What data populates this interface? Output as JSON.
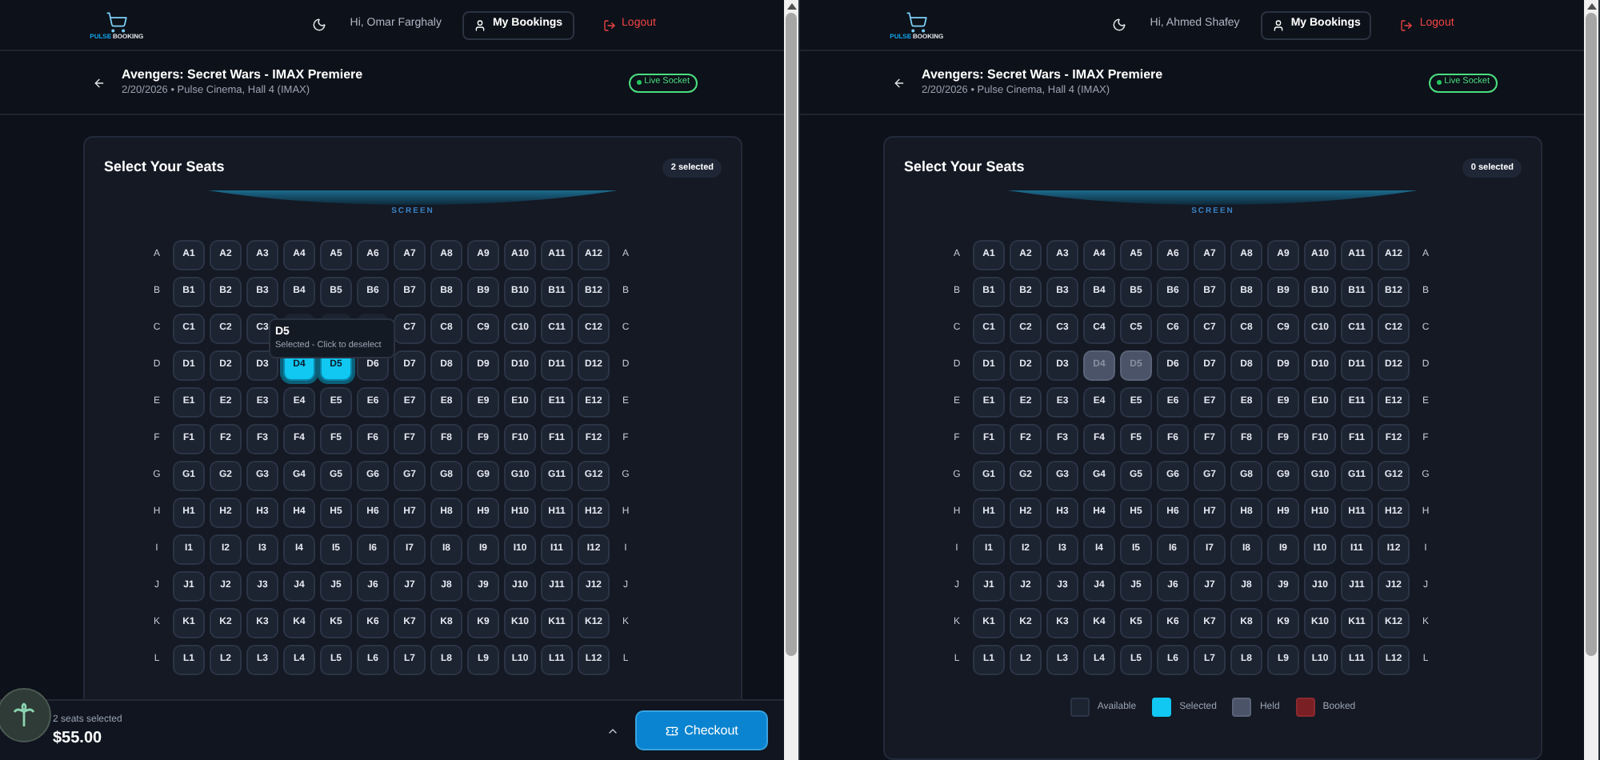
{
  "panes": [
    {
      "header": {
        "brand": [
          "PULSE",
          "BOOKING"
        ],
        "greeting": "Hi, Omar Farghaly",
        "bookings": "My Bookings",
        "logout": "Logout"
      },
      "event": {
        "title": "Avengers: Secret Wars - IMAX Premiere",
        "subtitle": "2/20/2026 • Pulse Cinema, Hall 4 (IMAX)",
        "status": "Live Socket"
      },
      "seat_map": {
        "title": "Select Your Seats",
        "count": "2 selected",
        "screen": "SCREEN",
        "rows": [
          {
            "label": "A",
            "label_right": "A",
            "seats": [
              {
                "label": "A1",
                "kind": "available"
              },
              {
                "label": "A2",
                "kind": "available"
              },
              {
                "label": "A3",
                "kind": "available"
              },
              {
                "label": "A4",
                "kind": "available"
              },
              {
                "label": "A5",
                "kind": "available"
              },
              {
                "label": "A6",
                "kind": "available"
              },
              {
                "label": "A7",
                "kind": "available"
              },
              {
                "label": "A8",
                "kind": "available"
              },
              {
                "label": "A9",
                "kind": "available"
              },
              {
                "label": "A10",
                "kind": "available"
              },
              {
                "label": "A11",
                "kind": "available"
              },
              {
                "label": "A12",
                "kind": "available"
              }
            ]
          },
          {
            "label": "B",
            "label_right": "B",
            "seats": [
              {
                "label": "B1",
                "kind": "available"
              },
              {
                "label": "B2",
                "kind": "available"
              },
              {
                "label": "B3",
                "kind": "available"
              },
              {
                "label": "B4",
                "kind": "available"
              },
              {
                "label": "B5",
                "kind": "available"
              },
              {
                "label": "B6",
                "kind": "available"
              },
              {
                "label": "B7",
                "kind": "available"
              },
              {
                "label": "B8",
                "kind": "available"
              },
              {
                "label": "B9",
                "kind": "available"
              },
              {
                "label": "B10",
                "kind": "available"
              },
              {
                "label": "B11",
                "kind": "available"
              },
              {
                "label": "B12",
                "kind": "available"
              }
            ]
          },
          {
            "label": "C",
            "label_right": "C",
            "seats": [
              {
                "label": "C1",
                "kind": "available"
              },
              {
                "label": "C2",
                "kind": "available"
              },
              {
                "label": "C3",
                "kind": "available"
              },
              {
                "kind": "covered"
              },
              {
                "kind": "covered"
              },
              {
                "kind": "covered"
              },
              {
                "label": "C7",
                "kind": "available"
              },
              {
                "label": "C8",
                "kind": "available"
              },
              {
                "label": "C9",
                "kind": "available"
              },
              {
                "label": "C10",
                "kind": "available"
              },
              {
                "label": "C11",
                "kind": "available"
              },
              {
                "label": "C12",
                "kind": "available"
              }
            ]
          },
          {
            "label": "D",
            "label_right": "D",
            "seats": [
              {
                "label": "D1",
                "kind": "available"
              },
              {
                "label": "D2",
                "kind": "available"
              },
              {
                "label": "D3",
                "kind": "available"
              },
              {
                "label": "D4",
                "kind": "selected"
              },
              {
                "label": "D5",
                "kind": "selected"
              },
              {
                "label": "D6",
                "kind": "available"
              },
              {
                "label": "D7",
                "kind": "available"
              },
              {
                "label": "D8",
                "kind": "available"
              },
              {
                "label": "D9",
                "kind": "available"
              },
              {
                "label": "D10",
                "kind": "available"
              },
              {
                "label": "D11",
                "kind": "available"
              },
              {
                "label": "D12",
                "kind": "available"
              }
            ]
          },
          {
            "label": "E",
            "label_right": "E",
            "seats": [
              {
                "label": "E1",
                "kind": "available"
              },
              {
                "label": "E2",
                "kind": "available"
              },
              {
                "label": "E3",
                "kind": "available"
              },
              {
                "label": "E4",
                "kind": "available"
              },
              {
                "label": "E5",
                "kind": "available"
              },
              {
                "label": "E6",
                "kind": "available"
              },
              {
                "label": "E7",
                "kind": "available"
              },
              {
                "label": "E8",
                "kind": "available"
              },
              {
                "label": "E9",
                "kind": "available"
              },
              {
                "label": "E10",
                "kind": "available"
              },
              {
                "label": "E11",
                "kind": "available"
              },
              {
                "label": "E12",
                "kind": "available"
              }
            ]
          },
          {
            "label": "F",
            "label_right": "F",
            "seats": [
              {
                "label": "F1",
                "kind": "available"
              },
              {
                "label": "F2",
                "kind": "available"
              },
              {
                "label": "F3",
                "kind": "available"
              },
              {
                "label": "F4",
                "kind": "available"
              },
              {
                "label": "F5",
                "kind": "available"
              },
              {
                "label": "F6",
                "kind": "available"
              },
              {
                "label": "F7",
                "kind": "available"
              },
              {
                "label": "F8",
                "kind": "available"
              },
              {
                "label": "F9",
                "kind": "available"
              },
              {
                "label": "F10",
                "kind": "available"
              },
              {
                "label": "F11",
                "kind": "available"
              },
              {
                "label": "F12",
                "kind": "available"
              }
            ]
          },
          {
            "label": "G",
            "label_right": "G",
            "seats": [
              {
                "label": "G1",
                "kind": "available"
              },
              {
                "label": "G2",
                "kind": "available"
              },
              {
                "label": "G3",
                "kind": "available"
              },
              {
                "label": "G4",
                "kind": "available"
              },
              {
                "label": "G5",
                "kind": "available"
              },
              {
                "label": "G6",
                "kind": "available"
              },
              {
                "label": "G7",
                "kind": "available"
              },
              {
                "label": "G8",
                "kind": "available"
              },
              {
                "label": "G9",
                "kind": "available"
              },
              {
                "label": "G10",
                "kind": "available"
              },
              {
                "label": "G11",
                "kind": "available"
              },
              {
                "label": "G12",
                "kind": "available"
              }
            ]
          },
          {
            "label": "H",
            "label_right": "H",
            "seats": [
              {
                "label": "H1",
                "kind": "available"
              },
              {
                "label": "H2",
                "kind": "available"
              },
              {
                "label": "H3",
                "kind": "available"
              },
              {
                "label": "H4",
                "kind": "available"
              },
              {
                "label": "H5",
                "kind": "available"
              },
              {
                "label": "H6",
                "kind": "available"
              },
              {
                "label": "H7",
                "kind": "available"
              },
              {
                "label": "H8",
                "kind": "available"
              },
              {
                "label": "H9",
                "kind": "available"
              },
              {
                "label": "H10",
                "kind": "available"
              },
              {
                "label": "H11",
                "kind": "available"
              },
              {
                "label": "H12",
                "kind": "available"
              }
            ]
          },
          {
            "label": "I",
            "label_right": "I",
            "seats": [
              {
                "label": "I1",
                "kind": "available"
              },
              {
                "label": "I2",
                "kind": "available"
              },
              {
                "label": "I3",
                "kind": "available"
              },
              {
                "label": "I4",
                "kind": "available"
              },
              {
                "label": "I5",
                "kind": "available"
              },
              {
                "label": "I6",
                "kind": "available"
              },
              {
                "label": "I7",
                "kind": "available"
              },
              {
                "label": "I8",
                "kind": "available"
              },
              {
                "label": "I9",
                "kind": "available"
              },
              {
                "label": "I10",
                "kind": "available"
              },
              {
                "label": "I11",
                "kind": "available"
              },
              {
                "label": "I12",
                "kind": "available"
              }
            ]
          },
          {
            "label": "J",
            "label_right": "J",
            "seats": [
              {
                "label": "J1",
                "kind": "available"
              },
              {
                "label": "J2",
                "kind": "available"
              },
              {
                "label": "J3",
                "kind": "available"
              },
              {
                "label": "J4",
                "kind": "available"
              },
              {
                "label": "J5",
                "kind": "available"
              },
              {
                "label": "J6",
                "kind": "available"
              },
              {
                "label": "J7",
                "kind": "available"
              },
              {
                "label": "J8",
                "kind": "available"
              },
              {
                "label": "J9",
                "kind": "available"
              },
              {
                "label": "J10",
                "kind": "available"
              },
              {
                "label": "J11",
                "kind": "available"
              },
              {
                "label": "J12",
                "kind": "available"
              }
            ]
          },
          {
            "label": "K",
            "label_right": "K",
            "seats": [
              {
                "label": "K1",
                "kind": "available"
              },
              {
                "label": "K2",
                "kind": "available"
              },
              {
                "label": "K3",
                "kind": "available"
              },
              {
                "label": "K4",
                "kind": "available"
              },
              {
                "label": "K5",
                "kind": "available"
              },
              {
                "label": "K6",
                "kind": "available"
              },
              {
                "label": "K7",
                "kind": "available"
              },
              {
                "label": "K8",
                "kind": "available"
              },
              {
                "label": "K9",
                "kind": "available"
              },
              {
                "label": "K10",
                "kind": "available"
              },
              {
                "label": "K11",
                "kind": "available"
              },
              {
                "label": "K12",
                "kind": "available"
              }
            ]
          },
          {
            "label": "L",
            "label_right": "L",
            "seats": [
              {
                "label": "L1",
                "kind": "available"
              },
              {
                "label": "L2",
                "kind": "available"
              },
              {
                "label": "L3",
                "kind": "available"
              },
              {
                "label": "L4",
                "kind": "available"
              },
              {
                "label": "L5",
                "kind": "available"
              },
              {
                "label": "L6",
                "kind": "available"
              },
              {
                "label": "L7",
                "kind": "available"
              },
              {
                "label": "L8",
                "kind": "available"
              },
              {
                "label": "L9",
                "kind": "available"
              },
              {
                "label": "L10",
                "kind": "available"
              },
              {
                "label": "L11",
                "kind": "available"
              },
              {
                "label": "L12",
                "kind": "available"
              }
            ]
          }
        ]
      },
      "tooltip": {
        "title": "D5",
        "text": "Selected - Click to deselect"
      },
      "footer": {
        "summary": "2 seats selected",
        "total": "$55.00",
        "checkout": "Checkout"
      }
    },
    {
      "header": {
        "brand": [
          "PULSE",
          "BOOKING"
        ],
        "greeting": "Hi, Ahmed Shafey",
        "bookings": "My Bookings",
        "logout": "Logout"
      },
      "event": {
        "title": "Avengers: Secret Wars - IMAX Premiere",
        "subtitle": "2/20/2026 • Pulse Cinema, Hall 4 (IMAX)",
        "status": "Live Socket"
      },
      "seat_map": {
        "title": "Select Your Seats",
        "count": "0 selected",
        "screen": "SCREEN",
        "rows": [
          {
            "label": "A",
            "label_right": "A",
            "seats": [
              {
                "label": "A1",
                "kind": "available"
              },
              {
                "label": "A2",
                "kind": "available"
              },
              {
                "label": "A3",
                "kind": "available"
              },
              {
                "label": "A4",
                "kind": "available"
              },
              {
                "label": "A5",
                "kind": "available"
              },
              {
                "label": "A6",
                "kind": "available"
              },
              {
                "label": "A7",
                "kind": "available"
              },
              {
                "label": "A8",
                "kind": "available"
              },
              {
                "label": "A9",
                "kind": "available"
              },
              {
                "label": "A10",
                "kind": "available"
              },
              {
                "label": "A11",
                "kind": "available"
              },
              {
                "label": "A12",
                "kind": "available"
              }
            ]
          },
          {
            "label": "B",
            "label_right": "B",
            "seats": [
              {
                "label": "B1",
                "kind": "available"
              },
              {
                "label": "B2",
                "kind": "available"
              },
              {
                "label": "B3",
                "kind": "available"
              },
              {
                "label": "B4",
                "kind": "available"
              },
              {
                "label": "B5",
                "kind": "available"
              },
              {
                "label": "B6",
                "kind": "available"
              },
              {
                "label": "B7",
                "kind": "available"
              },
              {
                "label": "B8",
                "kind": "available"
              },
              {
                "label": "B9",
                "kind": "available"
              },
              {
                "label": "B10",
                "kind": "available"
              },
              {
                "label": "B11",
                "kind": "available"
              },
              {
                "label": "B12",
                "kind": "available"
              }
            ]
          },
          {
            "label": "C",
            "label_right": "C",
            "seats": [
              {
                "label": "C1",
                "kind": "available"
              },
              {
                "label": "C2",
                "kind": "available"
              },
              {
                "label": "C3",
                "kind": "available"
              },
              {
                "label": "C4",
                "kind": "available"
              },
              {
                "label": "C5",
                "kind": "available"
              },
              {
                "label": "C6",
                "kind": "available"
              },
              {
                "label": "C7",
                "kind": "available"
              },
              {
                "label": "C8",
                "kind": "available"
              },
              {
                "label": "C9",
                "kind": "available"
              },
              {
                "label": "C10",
                "kind": "available"
              },
              {
                "label": "C11",
                "kind": "available"
              },
              {
                "label": "C12",
                "kind": "available"
              }
            ]
          },
          {
            "label": "D",
            "label_right": "D",
            "seats": [
              {
                "label": "D1",
                "kind": "available"
              },
              {
                "label": "D2",
                "kind": "available"
              },
              {
                "label": "D3",
                "kind": "available"
              },
              {
                "label": "D4",
                "kind": "held"
              },
              {
                "label": "D5",
                "kind": "held"
              },
              {
                "label": "D6",
                "kind": "available"
              },
              {
                "label": "D7",
                "kind": "available"
              },
              {
                "label": "D8",
                "kind": "available"
              },
              {
                "label": "D9",
                "kind": "available"
              },
              {
                "label": "D10",
                "kind": "available"
              },
              {
                "label": "D11",
                "kind": "available"
              },
              {
                "label": "D12",
                "kind": "available"
              }
            ]
          },
          {
            "label": "E",
            "label_right": "E",
            "seats": [
              {
                "label": "E1",
                "kind": "available"
              },
              {
                "label": "E2",
                "kind": "available"
              },
              {
                "label": "E3",
                "kind": "available"
              },
              {
                "label": "E4",
                "kind": "available"
              },
              {
                "label": "E5",
                "kind": "available"
              },
              {
                "label": "E6",
                "kind": "available"
              },
              {
                "label": "E7",
                "kind": "available"
              },
              {
                "label": "E8",
                "kind": "available"
              },
              {
                "label": "E9",
                "kind": "available"
              },
              {
                "label": "E10",
                "kind": "available"
              },
              {
                "label": "E11",
                "kind": "available"
              },
              {
                "label": "E12",
                "kind": "available"
              }
            ]
          },
          {
            "label": "F",
            "label_right": "F",
            "seats": [
              {
                "label": "F1",
                "kind": "available"
              },
              {
                "label": "F2",
                "kind": "available"
              },
              {
                "label": "F3",
                "kind": "available"
              },
              {
                "label": "F4",
                "kind": "available"
              },
              {
                "label": "F5",
                "kind": "available"
              },
              {
                "label": "F6",
                "kind": "available"
              },
              {
                "label": "F7",
                "kind": "available"
              },
              {
                "label": "F8",
                "kind": "available"
              },
              {
                "label": "F9",
                "kind": "available"
              },
              {
                "label": "F10",
                "kind": "available"
              },
              {
                "label": "F11",
                "kind": "available"
              },
              {
                "label": "F12",
                "kind": "available"
              }
            ]
          },
          {
            "label": "G",
            "label_right": "G",
            "seats": [
              {
                "label": "G1",
                "kind": "available"
              },
              {
                "label": "G2",
                "kind": "available"
              },
              {
                "label": "G3",
                "kind": "available"
              },
              {
                "label": "G4",
                "kind": "available"
              },
              {
                "label": "G5",
                "kind": "available"
              },
              {
                "label": "G6",
                "kind": "available"
              },
              {
                "label": "G7",
                "kind": "available"
              },
              {
                "label": "G8",
                "kind": "available"
              },
              {
                "label": "G9",
                "kind": "available"
              },
              {
                "label": "G10",
                "kind": "available"
              },
              {
                "label": "G11",
                "kind": "available"
              },
              {
                "label": "G12",
                "kind": "available"
              }
            ]
          },
          {
            "label": "H",
            "label_right": "H",
            "seats": [
              {
                "label": "H1",
                "kind": "available"
              },
              {
                "label": "H2",
                "kind": "available"
              },
              {
                "label": "H3",
                "kind": "available"
              },
              {
                "label": "H4",
                "kind": "available"
              },
              {
                "label": "H5",
                "kind": "available"
              },
              {
                "label": "H6",
                "kind": "available"
              },
              {
                "label": "H7",
                "kind": "available"
              },
              {
                "label": "H8",
                "kind": "available"
              },
              {
                "label": "H9",
                "kind": "available"
              },
              {
                "label": "H10",
                "kind": "available"
              },
              {
                "label": "H11",
                "kind": "available"
              },
              {
                "label": "H12",
                "kind": "available"
              }
            ]
          },
          {
            "label": "I",
            "label_right": "I",
            "seats": [
              {
                "label": "I1",
                "kind": "available"
              },
              {
                "label": "I2",
                "kind": "available"
              },
              {
                "label": "I3",
                "kind": "available"
              },
              {
                "label": "I4",
                "kind": "available"
              },
              {
                "label": "I5",
                "kind": "available"
              },
              {
                "label": "I6",
                "kind": "available"
              },
              {
                "label": "I7",
                "kind": "available"
              },
              {
                "label": "I8",
                "kind": "available"
              },
              {
                "label": "I9",
                "kind": "available"
              },
              {
                "label": "I10",
                "kind": "available"
              },
              {
                "label": "I11",
                "kind": "available"
              },
              {
                "label": "I12",
                "kind": "available"
              }
            ]
          },
          {
            "label": "J",
            "label_right": "J",
            "seats": [
              {
                "label": "J1",
                "kind": "available"
              },
              {
                "label": "J2",
                "kind": "available"
              },
              {
                "label": "J3",
                "kind": "available"
              },
              {
                "label": "J4",
                "kind": "available"
              },
              {
                "label": "J5",
                "kind": "available"
              },
              {
                "label": "J6",
                "kind": "available"
              },
              {
                "label": "J7",
                "kind": "available"
              },
              {
                "label": "J8",
                "kind": "available"
              },
              {
                "label": "J9",
                "kind": "available"
              },
              {
                "label": "J10",
                "kind": "available"
              },
              {
                "label": "J11",
                "kind": "available"
              },
              {
                "label": "J12",
                "kind": "available"
              }
            ]
          },
          {
            "label": "K",
            "label_right": "K",
            "seats": [
              {
                "label": "K1",
                "kind": "available"
              },
              {
                "label": "K2",
                "kind": "available"
              },
              {
                "label": "K3",
                "kind": "available"
              },
              {
                "label": "K4",
                "kind": "available"
              },
              {
                "label": "K5",
                "kind": "available"
              },
              {
                "label": "K6",
                "kind": "available"
              },
              {
                "label": "K7",
                "kind": "available"
              },
              {
                "label": "K8",
                "kind": "available"
              },
              {
                "label": "K9",
                "kind": "available"
              },
              {
                "label": "K10",
                "kind": "available"
              },
              {
                "label": "K11",
                "kind": "available"
              },
              {
                "label": "K12",
                "kind": "available"
              }
            ]
          },
          {
            "label": "L",
            "label_right": "L",
            "seats": [
              {
                "label": "L1",
                "kind": "available"
              },
              {
                "label": "L2",
                "kind": "available"
              },
              {
                "label": "L3",
                "kind": "available"
              },
              {
                "label": "L4",
                "kind": "available"
              },
              {
                "label": "L5",
                "kind": "available"
              },
              {
                "label": "L6",
                "kind": "available"
              },
              {
                "label": "L7",
                "kind": "available"
              },
              {
                "label": "L8",
                "kind": "available"
              },
              {
                "label": "L9",
                "kind": "available"
              },
              {
                "label": "L10",
                "kind": "available"
              },
              {
                "label": "L11",
                "kind": "available"
              },
              {
                "label": "L12",
                "kind": "available"
              }
            ]
          }
        ]
      },
      "legend": [
        {
          "label": "Available",
          "kind": "available"
        },
        {
          "label": "Selected",
          "kind": "selected"
        },
        {
          "label": "Held",
          "kind": "held"
        },
        {
          "label": "Booked",
          "kind": "booked"
        }
      ]
    }
  ]
}
